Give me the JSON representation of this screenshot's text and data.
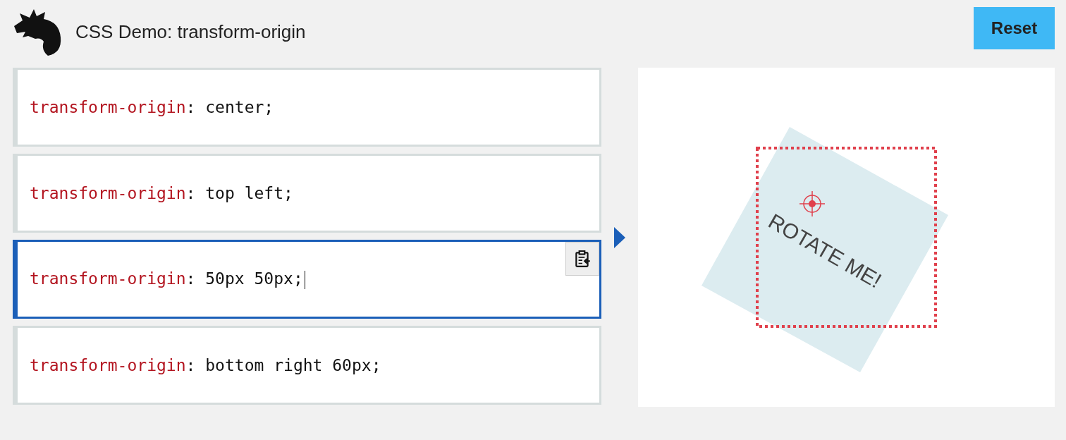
{
  "title": "CSS Demo: transform-origin",
  "reset": "Reset",
  "examples": [
    {
      "property": "transform-origin",
      "value": ": center;",
      "selected": false
    },
    {
      "property": "transform-origin",
      "value": ": top left;",
      "selected": false
    },
    {
      "property": "transform-origin",
      "value": ": 50px 50px;",
      "selected": true
    },
    {
      "property": "transform-origin",
      "value": ": bottom right 60px;",
      "selected": false
    }
  ],
  "preview": {
    "label": "ROTATE ME!"
  }
}
